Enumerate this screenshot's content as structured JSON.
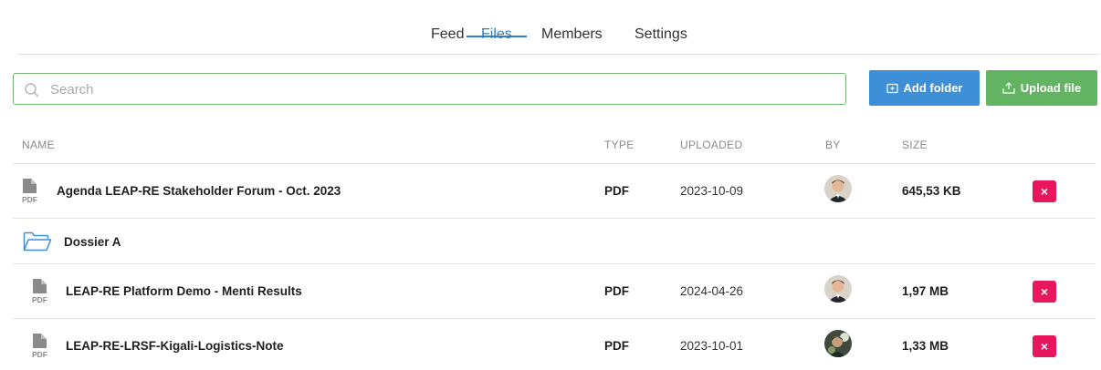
{
  "tabs": [
    {
      "label": "Feed",
      "active": false
    },
    {
      "label": "Files",
      "active": true
    },
    {
      "label": "Members",
      "active": false
    },
    {
      "label": "Settings",
      "active": false
    }
  ],
  "search": {
    "placeholder": "Search",
    "value": ""
  },
  "buttons": {
    "add_folder": "Add folder",
    "upload_file": "Upload file"
  },
  "columns": {
    "name": "NAME",
    "type": "TYPE",
    "uploaded": "UPLOADED",
    "by": "BY",
    "size": "SIZE"
  },
  "rows": [
    {
      "kind": "file",
      "icon": "pdf-file-icon",
      "name": "Agenda LEAP-RE Stakeholder Forum - Oct. 2023",
      "type": "PDF",
      "uploaded": "2023-10-09",
      "by": "avatar",
      "size": "645,53 KB",
      "delete": "×"
    },
    {
      "kind": "folder",
      "icon": "folder-icon",
      "name": "Dossier A"
    },
    {
      "kind": "file",
      "icon": "pdf-file-icon",
      "name": "LEAP-RE Platform Demo - Menti Results",
      "type": "PDF",
      "uploaded": "2024-04-26",
      "by": "avatar",
      "size": "1,97 MB",
      "delete": "×"
    },
    {
      "kind": "file",
      "icon": "pdf-file-icon",
      "name": "LEAP-RE-LRSF-Kigali-Logistics-Note",
      "type": "PDF",
      "uploaded": "2023-10-01",
      "by": "avatar",
      "size": "1,33 MB",
      "delete": "×"
    }
  ],
  "pdf_label": "PDF",
  "colors": {
    "accent": "#2f7fc4",
    "add_folder": "#3d8fd8",
    "upload_file": "#62b462",
    "delete": "#e8175d",
    "search_border": "#6fb56f"
  }
}
